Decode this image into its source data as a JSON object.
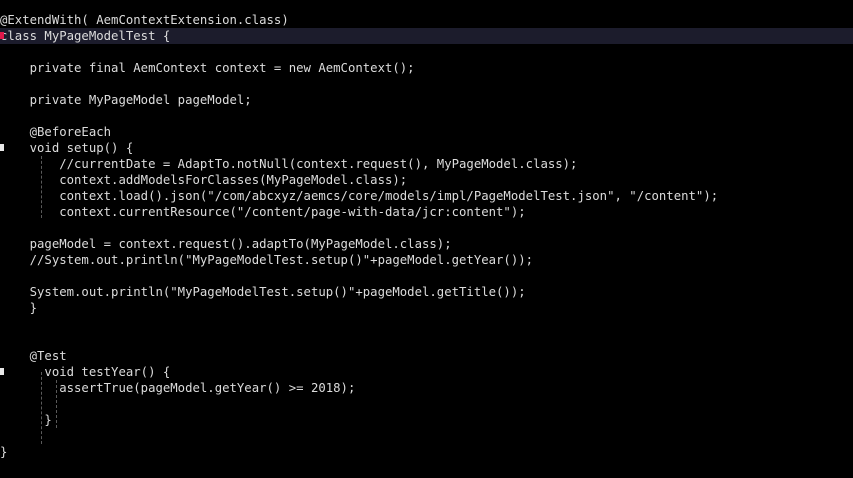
{
  "editor": {
    "lines": [
      "@ExtendWith( AemContextExtension.class)",
      "class MyPageModelTest {",
      "",
      "    private final AemContext context = new AemContext();",
      "",
      "    private MyPageModel pageModel;",
      "",
      "    @BeforeEach",
      "    void setup() {",
      "        //currentDate = AdaptTo.notNull(context.request(), MyPageModel.class);",
      "        context.addModelsForClasses(MyPageModel.class);",
      "        context.load().json(\"/com/abcxyz/aemcs/core/models/impl/PageModelTest.json\", \"/content\");",
      "        context.currentResource(\"/content/page-with-data/jcr:content\");",
      "",
      "    pageModel = context.request().adaptTo(MyPageModel.class);",
      "    //System.out.println(\"MyPageModelTest.setup()\"+pageModel.getYear());",
      "",
      "    System.out.println(\"MyPageModelTest.setup()\"+pageModel.getTitle());",
      "    }",
      "",
      "",
      "    @Test",
      "      void testYear() {",
      "        assertTrue(pageModel.getYear() >= 2018);",
      "",
      "      }",
      "",
      "",
      "}"
    ]
  }
}
